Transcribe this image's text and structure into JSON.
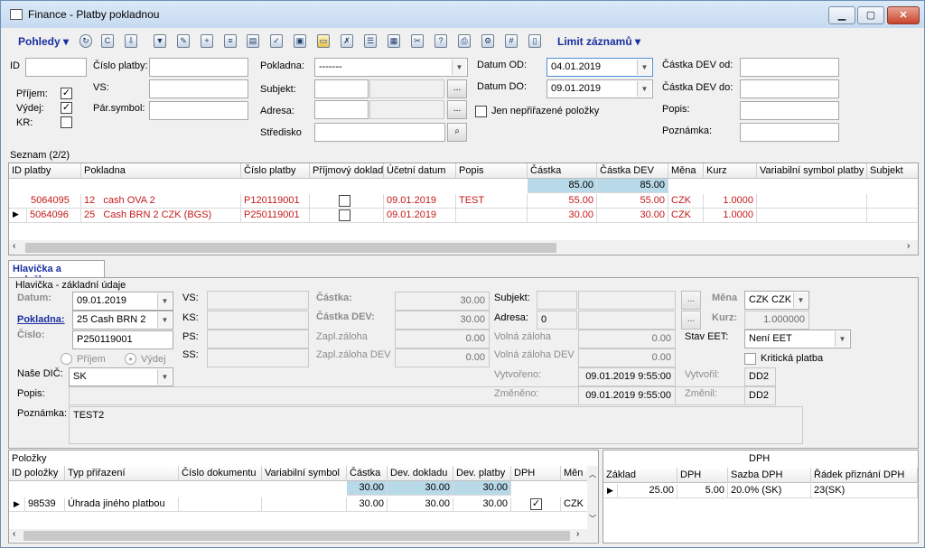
{
  "window": {
    "title": "Finance - Platby pokladnou",
    "min": "▁",
    "max": "▢",
    "close": "✕"
  },
  "toolbar": {
    "pohledy": "Pohledy",
    "limit": "Limit záznamů"
  },
  "filter": {
    "id_label": "ID",
    "id_value": "",
    "cislo_platby_label": "Číslo platby:",
    "cislo_platby_value": "",
    "vs_label": "VS:",
    "vs_value": "",
    "parsymbol_label": "Pár.symbol:",
    "parsymbol_value": "",
    "prijem_label": "Příjem:",
    "vydej_label": "Výdej:",
    "kr_label": "KR:",
    "pokladna_label": "Pokladna:",
    "pokladna_value": "-------",
    "subjekt_label": "Subjekt:",
    "adresa_label": "Adresa:",
    "stredisko_label": "Středisko",
    "datum_od_label": "Datum OD:",
    "datum_od_value": "04.01.2019",
    "datum_do_label": "Datum DO:",
    "datum_do_value": "09.01.2019",
    "jen_label": "Jen nepřiřazené položky",
    "castka_od_label": "Částka DEV od:",
    "castka_do_label": "Částka DEV do:",
    "popis_label": "Popis:",
    "poznamka_label": "Poznámka:"
  },
  "list": {
    "title": "Seznam (2/2)",
    "columns": [
      "ID platby",
      "Pokladna",
      "Číslo platby",
      "Příjmový doklad",
      "Účetní datum",
      "Popis",
      "Částka",
      "Částka DEV",
      "Měna",
      "Kurz",
      "Variabilní symbol platby",
      "Subjekt"
    ],
    "sum_castka": "85.00",
    "sum_dev": "85.00",
    "rows": [
      {
        "id": "5064095",
        "pok_no": "12",
        "pok_name": "cash OVA 2",
        "cislo": "P120119001",
        "datum": "09.01.2019",
        "popis": "TEST",
        "castka": "55.00",
        "dev": "55.00",
        "mena": "CZK",
        "kurz": "1.0000"
      },
      {
        "id": "5064096",
        "pok_no": "25",
        "pok_name": "Cash BRN 2 CZK (BGS)",
        "cislo": "P250119001",
        "datum": "09.01.2019",
        "popis": "",
        "castka": "30.00",
        "dev": "30.00",
        "mena": "CZK",
        "kurz": "1.0000"
      }
    ]
  },
  "detail": {
    "tab": "Hlavička a položky",
    "section": "Hlavička - základní údaje",
    "datum_label": "Datum:",
    "datum_value": "09.01.2019",
    "pokladna_label": "Pokladna:",
    "pokladna_value": "25  Cash BRN 2",
    "cislo_label": "Číslo:",
    "cislo_value": "P250119001",
    "prijem": "Příjem",
    "vydej": "Výdej",
    "nase_dic_label": "Naše DIČ:",
    "nase_dic_value": "SK",
    "popis_label": "Popis:",
    "poznamka_label": "Poznámka:",
    "poznamka_value": "TEST2",
    "vs": "VS:",
    "ks": "KS:",
    "ps": "PS:",
    "ss": "SS:",
    "castka_label": "Částka:",
    "castka_value": "30.00",
    "castka_dev_label": "Částka DEV:",
    "castka_dev_value": "30.00",
    "zapl_label": "Zapl.záloha",
    "zapl_value": "0.00",
    "zapl_dev_label": "Zapl.záloha DEV",
    "zapl_dev_value": "0.00",
    "subjekt_label": "Subjekt:",
    "adresa_label": "Adresa:",
    "adresa_value": "0",
    "volna_label": "Volná záloha",
    "volna_value": "0.00",
    "volna_dev_label": "Volná záloha DEV",
    "volna_dev_value": "0.00",
    "vytvoreno_label": "Vytvořeno:",
    "vytvoreno_value": "09.01.2019 9:55:00",
    "zmeneno_label": "Změněno:",
    "zmeneno_value": "09.01.2019 9:55:00",
    "mena_label": "Měna",
    "mena_value": "CZK CZK",
    "kurz_label": "Kurz:",
    "kurz_value": "1.000000",
    "stav_label": "Stav EET:",
    "stav_value": "Není EET",
    "kriticka_label": "Kritická platba",
    "vytvoril_label": "Vytvořil:",
    "vytvoril_value": "DD2",
    "zmenil_label": "Změnil:",
    "zmenil_value": "DD2"
  },
  "polozky": {
    "title": "Položky",
    "columns": [
      "ID položky",
      "Typ přiřazení",
      "Číslo dokumentu",
      "Variabilní symbol",
      "Částka",
      "Dev. dokladu",
      "Dev. platby",
      "DPH",
      "Měn"
    ],
    "sums": [
      "30.00",
      "30.00",
      "30.00"
    ],
    "row": {
      "id": "98539",
      "typ": "Úhrada jiného platbou",
      "castka": "30.00",
      "dev_dokl": "30.00",
      "dev_pl": "30.00",
      "mena": "CZK"
    }
  },
  "dph": {
    "title": "DPH",
    "columns": [
      "Základ",
      "DPH",
      "Sazba DPH",
      "Řádek přiznání DPH"
    ],
    "row": {
      "zaklad": "25.00",
      "dph": "5.00",
      "sazba": "20.0% (SK)",
      "radek": "23(SK)"
    }
  }
}
